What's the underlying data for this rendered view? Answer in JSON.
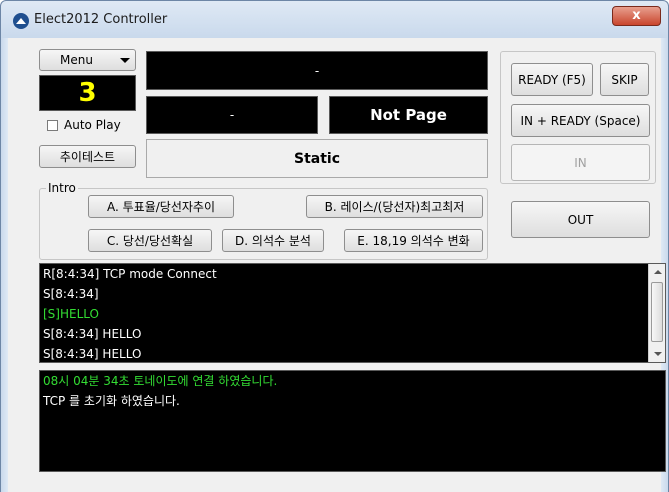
{
  "window": {
    "title": "Elect2012 Controller",
    "close_glyph": "x"
  },
  "left": {
    "menu_label": "Menu",
    "counter": "3",
    "auto_play_label": "Auto Play",
    "test_button": "추이테스트"
  },
  "display": {
    "top_text": "-",
    "mid_left_text": "-",
    "not_page_text": "Not Page",
    "static_text": "Static"
  },
  "intro": {
    "legend": "Intro",
    "buttons": {
      "a": "A. 투표율/당선자추이",
      "b": "B. 레이스/(당선자)최고최저",
      "c": "C. 당선/당선확실",
      "d": "D. 의석수 분석",
      "e": "E. 18,19 의석수 변화"
    }
  },
  "right": {
    "ready_f5": "READY (F5)",
    "skip": "SKIP",
    "in_ready_space": "IN + READY (Space)",
    "in": "IN",
    "out": "OUT"
  },
  "log1": [
    {
      "text": "R[8:4:34] TCP mode Connect",
      "color": "#ffffff"
    },
    {
      "text": "S[8:4:34]",
      "color": "#ffffff"
    },
    {
      "text": "[S]HELLO",
      "color": "#33dd33"
    },
    {
      "text": "S[8:4:34] HELLO",
      "color": "#ffffff"
    },
    {
      "text": "S[8:4:34] HELLO",
      "color": "#ffffff"
    }
  ],
  "log2": [
    {
      "text": "08시 04분 34초 토네이도에 연결 하였습니다.",
      "color": "#33dd33"
    },
    {
      "text": "TCP 를 초기화 하였습니다.",
      "color": "#ffffff"
    }
  ],
  "colors": {
    "counter_yellow": "#ffff00",
    "log_green": "#33dd33"
  }
}
